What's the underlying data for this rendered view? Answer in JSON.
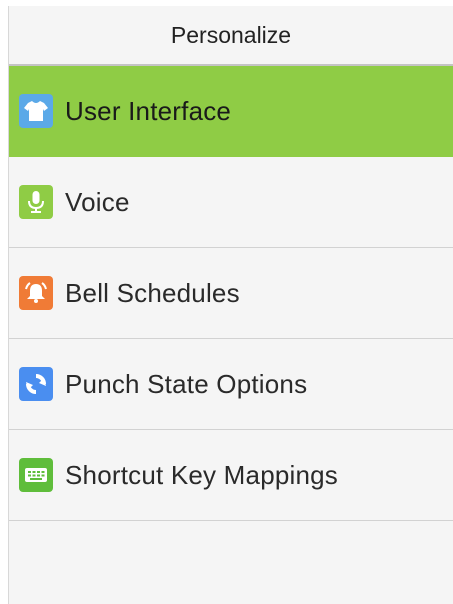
{
  "header": {
    "title": "Personalize"
  },
  "menu": {
    "items": [
      {
        "label": "User Interface",
        "icon": "shirt-icon",
        "icon_color": "#5ba9e8",
        "active": true
      },
      {
        "label": "Voice",
        "icon": "microphone-icon",
        "icon_color": "#8fcc45",
        "active": false
      },
      {
        "label": "Bell Schedules",
        "icon": "bell-icon",
        "icon_color": "#f07b36",
        "active": false
      },
      {
        "label": "Punch State Options",
        "icon": "refresh-icon",
        "icon_color": "#4a8ef0",
        "active": false
      },
      {
        "label": "Shortcut Key Mappings",
        "icon": "keyboard-icon",
        "icon_color": "#5fbd3b",
        "active": false
      }
    ]
  },
  "colors": {
    "active_background": "#8fcc45",
    "screen_background": "#f5f5f5"
  }
}
